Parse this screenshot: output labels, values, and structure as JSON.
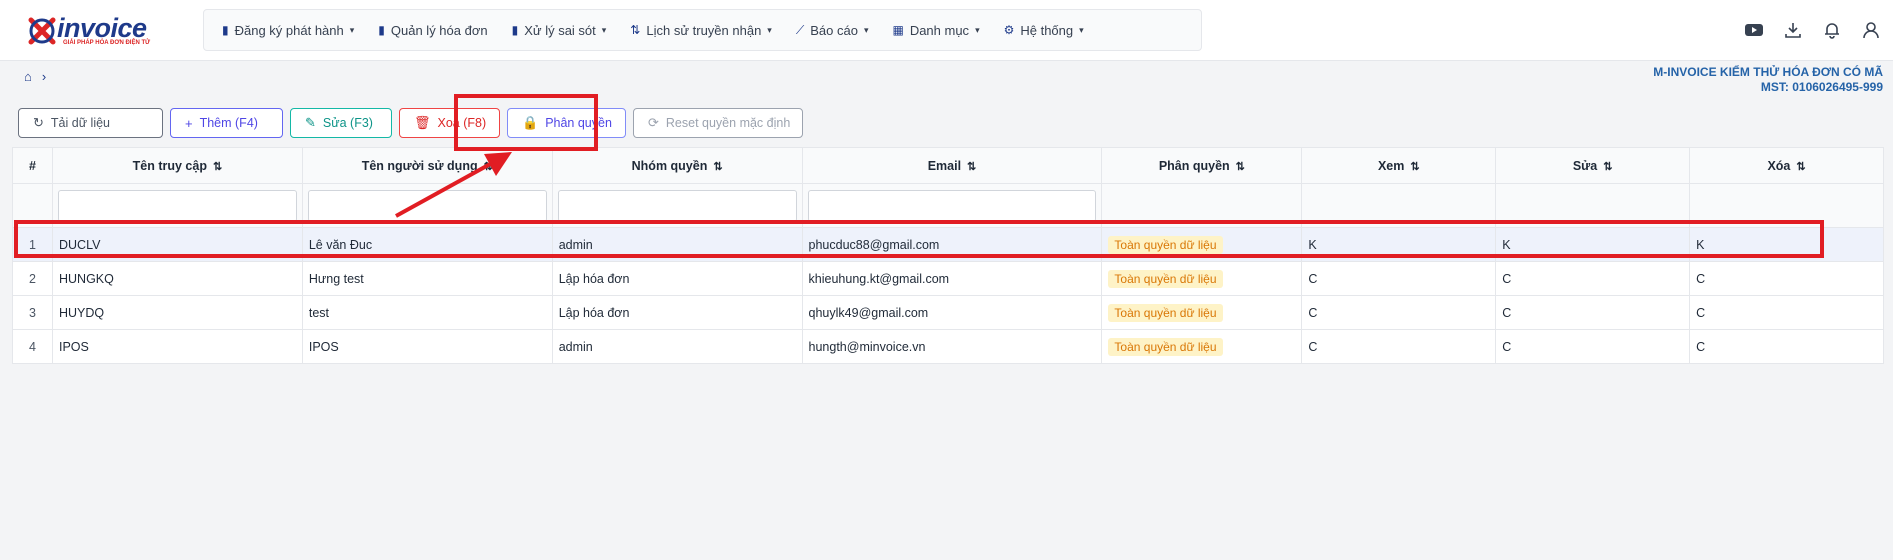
{
  "logo": {
    "text": "invoice",
    "tagline": "GIẢI PHÁP HÓA ĐƠN ĐIỆN TỬ"
  },
  "menu": [
    {
      "label": "Đăng ký phát hành",
      "icon": "file-doc-icon",
      "dropdown": true
    },
    {
      "label": "Quản lý hóa đơn",
      "icon": "file-icon",
      "dropdown": false
    },
    {
      "label": "Xử lý sai sót",
      "icon": "file-edit-icon",
      "dropdown": true
    },
    {
      "label": "Lịch sử truyền nhận",
      "icon": "transfer-icon",
      "dropdown": true
    },
    {
      "label": "Báo cáo",
      "icon": "chart-icon",
      "dropdown": true
    },
    {
      "label": "Danh mục",
      "icon": "grid-icon",
      "dropdown": true
    },
    {
      "label": "Hệ thống",
      "icon": "gear-icon",
      "dropdown": true
    }
  ],
  "header_icons": [
    "youtube-icon",
    "download-icon",
    "bell-icon",
    "user-icon"
  ],
  "company": {
    "name": "M-INVOICE KIỂM THỬ HÓA ĐƠN CÓ MÃ",
    "tax": "MST: 0106026495-999"
  },
  "toolbar": {
    "refresh": "Tải dữ liệu",
    "add": "Thêm (F4)",
    "edit": "Sửa (F3)",
    "delete": "Xoá (F8)",
    "permission": "Phân quyền",
    "reset": "Reset quyền mặc định"
  },
  "table": {
    "columns": [
      "#",
      "Tên truy cập",
      "Tên người sử dụng",
      "Nhóm quyền",
      "Email",
      "Phân quyền",
      "Xem",
      "Sửa",
      "Xóa"
    ],
    "rows": [
      {
        "no": "1",
        "username": "DUCLV",
        "fullname": "Lê văn Đuc",
        "group": "admin",
        "email": "phucduc88@gmail.com",
        "permission": "Toàn quyền dữ liệu",
        "view": "K",
        "edit": "K",
        "delete": "K"
      },
      {
        "no": "2",
        "username": "HUNGKQ",
        "fullname": "Hưng test",
        "group": "Lập hóa đơn",
        "email": "khieuhung.kt@gmail.com",
        "permission": "Toàn quyền dữ liệu",
        "view": "C",
        "edit": "C",
        "delete": "C"
      },
      {
        "no": "3",
        "username": "HUYDQ",
        "fullname": "test",
        "group": "Lập hóa đơn",
        "email": "qhuylk49@gmail.com",
        "permission": "Toàn quyền dữ liệu",
        "view": "C",
        "edit": "C",
        "delete": "C"
      },
      {
        "no": "4",
        "username": "IPOS",
        "fullname": "IPOS",
        "group": "admin",
        "email": "hungth@minvoice.vn",
        "permission": "Toàn quyền dữ liệu",
        "view": "C",
        "edit": "C",
        "delete": "C"
      }
    ]
  },
  "colors": {
    "brand": "#1e3a8a",
    "annotation": "#e11d23",
    "badge_bg": "#fef3c7",
    "badge_text": "#d97706"
  }
}
